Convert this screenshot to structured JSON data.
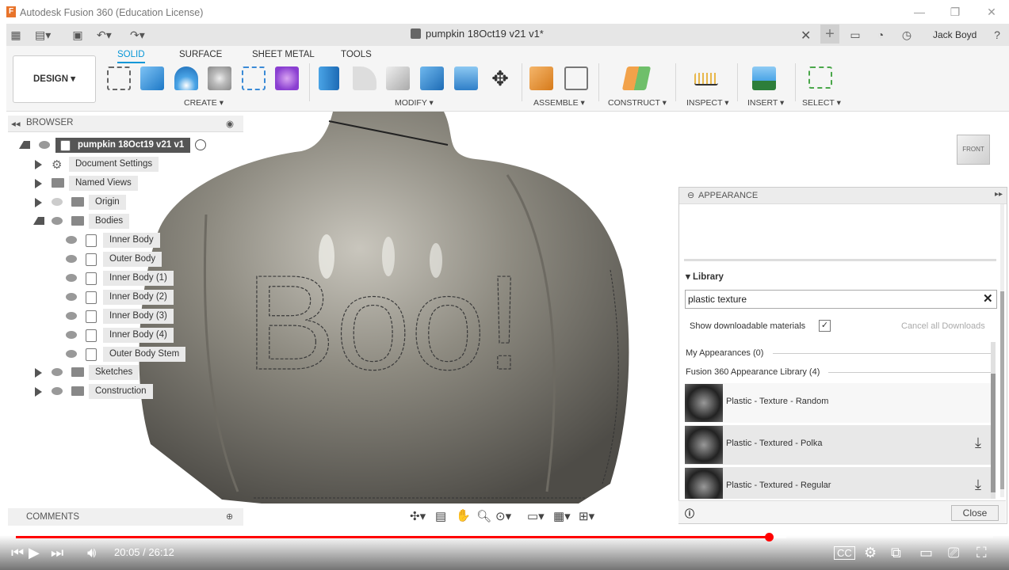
{
  "window": {
    "title": "Autodesk Fusion 360 (Education License)"
  },
  "document": {
    "tab_title": "pumpkin 18Oct19 v21 v1*"
  },
  "user": {
    "name": "Jack Boyd"
  },
  "ribbon": {
    "tabs": [
      "SOLID",
      "SURFACE",
      "SHEET METAL",
      "TOOLS"
    ],
    "active_tab": "SOLID",
    "workspace": "DESIGN ▾",
    "groups": [
      "CREATE ▾",
      "MODIFY ▾",
      "ASSEMBLE ▾",
      "CONSTRUCT ▾",
      "INSPECT ▾",
      "INSERT ▾",
      "SELECT ▾"
    ]
  },
  "browser": {
    "title": "BROWSER",
    "root": "pumpkin 18Oct19 v21 v1",
    "items": [
      {
        "label": "Document Settings"
      },
      {
        "label": "Named Views"
      },
      {
        "label": "Origin"
      },
      {
        "label": "Bodies"
      },
      {
        "label": "Inner Body"
      },
      {
        "label": "Outer Body"
      },
      {
        "label": "Inner Body (1)"
      },
      {
        "label": "Inner Body (2)"
      },
      {
        "label": "Inner Body (3)"
      },
      {
        "label": "Inner Body (4)"
      },
      {
        "label": "Outer Body Stem"
      },
      {
        "label": "Sketches"
      },
      {
        "label": "Construction"
      }
    ]
  },
  "viewport": {
    "model_text": "Boo!",
    "viewcube_face": "FRONT"
  },
  "appearance": {
    "title": "APPEARANCE",
    "library_label": "Library",
    "search_value": "plastic texture",
    "show_downloadable_label": "Show downloadable materials",
    "cancel_downloads": "Cancel all Downloads",
    "my_appearances": "My Appearances (0)",
    "library_section": "Fusion 360 Appearance Library (4)",
    "materials": [
      {
        "name": "Plastic - Texture - Random"
      },
      {
        "name": "Plastic - Textured - Polka"
      },
      {
        "name": "Plastic - Textured - Regular"
      }
    ],
    "close_label": "Close"
  },
  "comments": {
    "title": "COMMENTS"
  },
  "player": {
    "time": "20:05 / 26:12",
    "progress_fraction": 0.771
  }
}
